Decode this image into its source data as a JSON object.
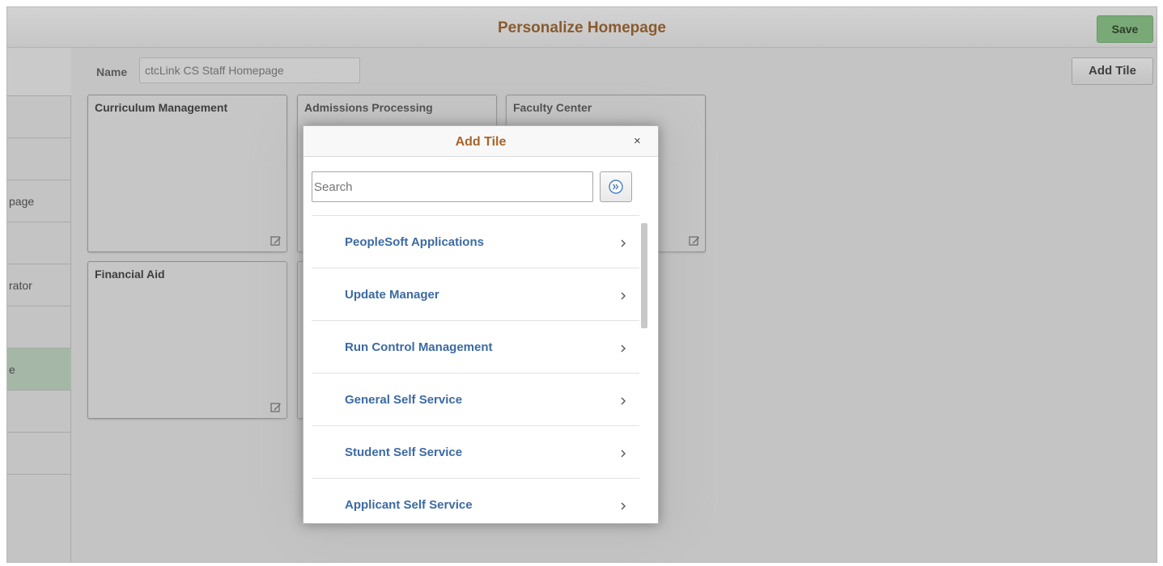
{
  "header": {
    "title": "Personalize Homepage",
    "save_label": "Save"
  },
  "sidebar": {
    "items": [
      {
        "label": ""
      },
      {
        "label": ""
      },
      {
        "label": ""
      },
      {
        "label": "page"
      },
      {
        "label": ""
      },
      {
        "label": "rator"
      },
      {
        "label": ""
      },
      {
        "label": "e"
      },
      {
        "label": ""
      },
      {
        "label": ""
      }
    ]
  },
  "main": {
    "name_label": "Name",
    "name_value": "ctcLink CS Staff Homepage",
    "add_tile_label": "Add Tile",
    "tiles": [
      {
        "title": "Curriculum Management"
      },
      {
        "title": "Admissions Processing"
      },
      {
        "title": "Faculty Center"
      },
      {
        "title": "Financial Aid"
      }
    ]
  },
  "modal": {
    "title": "Add Tile",
    "close_glyph": "×",
    "search_placeholder": "Search",
    "items": [
      {
        "label": "PeopleSoft Applications"
      },
      {
        "label": "Update Manager"
      },
      {
        "label": "Run Control Management"
      },
      {
        "label": "General Self Service"
      },
      {
        "label": "Student Self Service"
      },
      {
        "label": "Applicant Self Service"
      }
    ]
  },
  "colors": {
    "accent_title": "#8a5a2e",
    "save_button": "#79a977",
    "link_blue": "#3c6aa3",
    "selected_sidebar": "#a5b7a6"
  }
}
